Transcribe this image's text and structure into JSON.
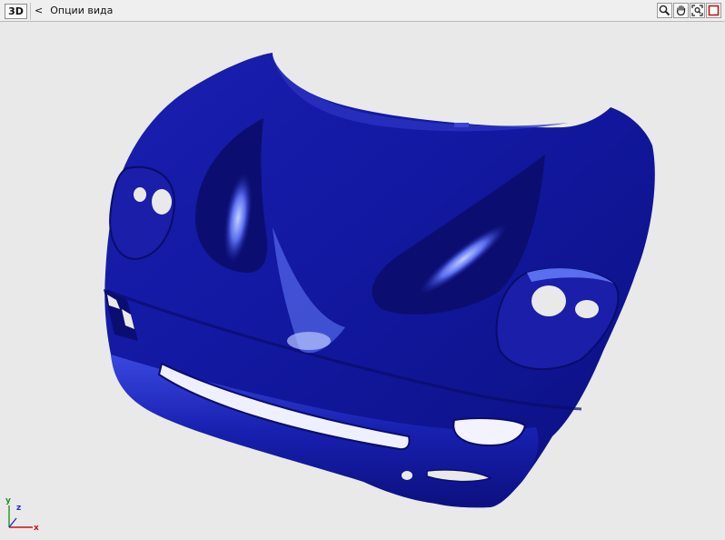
{
  "toolbar": {
    "mode_label": "3D",
    "back_glyph": "<",
    "title": "Опции вида",
    "tools": [
      {
        "icon": "zoom-icon"
      },
      {
        "icon": "pan-hand-icon"
      },
      {
        "icon": "fit-view-icon"
      },
      {
        "icon": "close-view-icon"
      }
    ]
  },
  "axes": {
    "x_label": "x",
    "y_label": "y",
    "z_label": "z",
    "x_color": "#d01010",
    "y_color": "#1a9a1a",
    "z_color": "#2a2acc"
  },
  "model": {
    "name": "car-hood-surface",
    "surface_color": "#1a1ea8",
    "highlight_color": "#8fa6ff",
    "shadow_color": "#0a0c6a",
    "background_color": "#e9e9e9"
  }
}
